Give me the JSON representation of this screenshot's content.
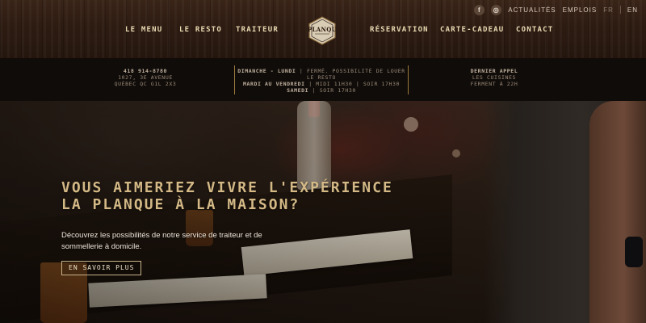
{
  "topbar": {
    "facebook_icon": "f",
    "instagram_icon": "◎",
    "actualites": "ACTUALITÉS",
    "emplois": "EMPLOIS",
    "lang_fr": "FR",
    "lang_en": "EN"
  },
  "nav": {
    "menu": "LE MENU",
    "resto": "LE RESTO",
    "traiteur": "TRAITEUR",
    "reservation": "RÉSERVATION",
    "carte_cadeau": "CARTE-CADEAU",
    "contact": "CONTACT"
  },
  "logo": {
    "text": "PLANQUE"
  },
  "info": {
    "phone": "418 914-8780",
    "address1": "1027, 3E AVENUE",
    "address2": "QUÉBEC QC G1L 2X3",
    "hours1_day": "DIMANCHE - LUNDI",
    "hours1_text": " | FERMÉ. POSSIBILITÉ DE LOUER LE RESTO",
    "hours2_day": "MARDI AU VENDREDI",
    "hours2_text": " | MIDI 11H30 | SOIR 17H30",
    "hours3_day": "SAMEDI",
    "hours3_text": " | SOIR 17H30",
    "last_call_title": "DERNIER APPEL",
    "last_call_line1": "LES CUISINES",
    "last_call_line2": "FERMENT À 22H"
  },
  "hero": {
    "title_line1": "VOUS AIMERIEZ VIVRE L'EXPÉRIENCE",
    "title_line2": "LA PLANQUE À LA MAISON?",
    "desc_line1": "Découvrez les possibilités de notre service de traiteur et de",
    "desc_line2": "sommellerie à domicile.",
    "button": "EN SAVOIR PLUS"
  },
  "colors": {
    "nav_text": "#e8d9b2",
    "hero_title": "#d4b986",
    "divider": "#9a7a3c",
    "wood": "#2e1c12"
  }
}
